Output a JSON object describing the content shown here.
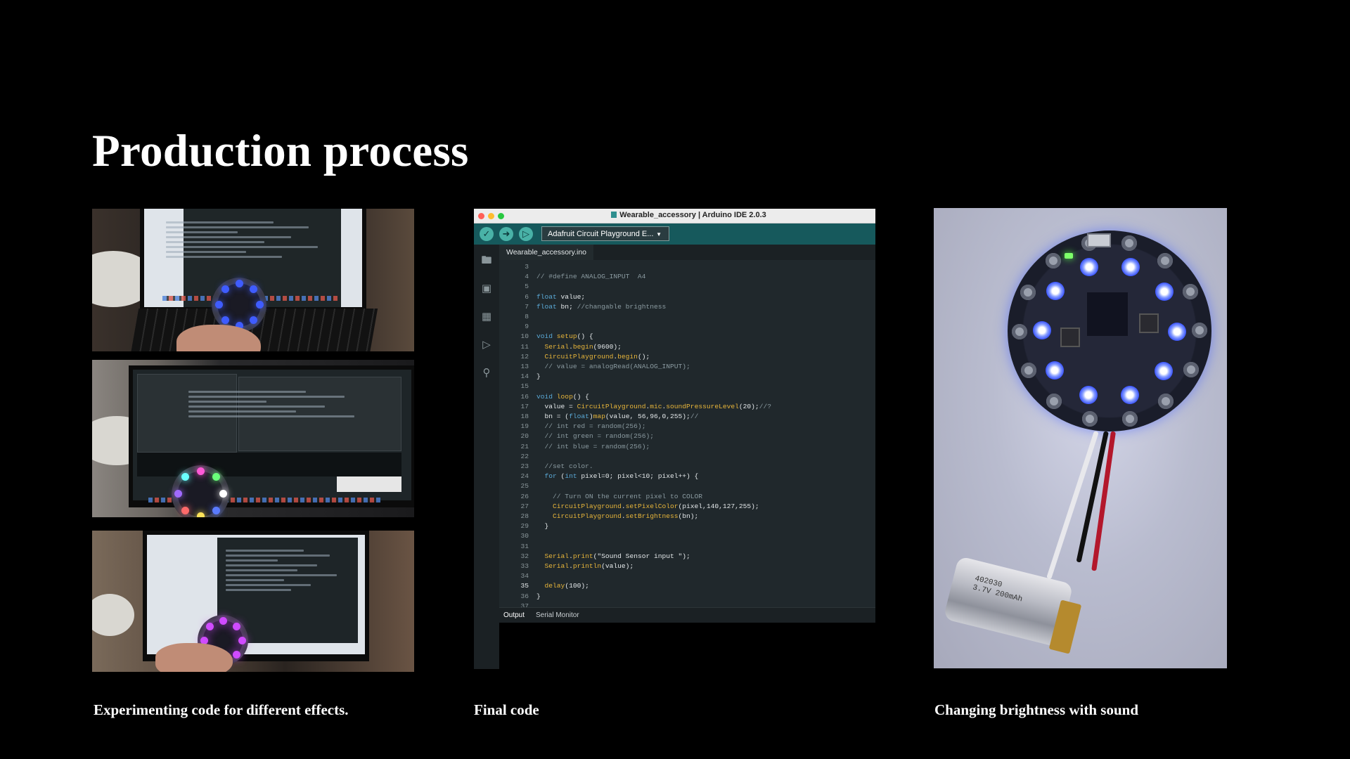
{
  "slide": {
    "title": "Production process",
    "captions": {
      "left": "Experimenting code for different effects.",
      "middle": "Final code",
      "right": "Changing brightness with sound"
    }
  },
  "ide": {
    "window_title": "Wearable_accessory | Arduino IDE 2.0.3",
    "board_select": "Adafruit Circuit Playground E...",
    "file_tab": "Wearable_accessory.ino",
    "output_tabs": [
      "Output",
      "Serial Monitor"
    ],
    "current_line": 35,
    "line_numbers": [
      3,
      4,
      5,
      6,
      7,
      8,
      9,
      10,
      11,
      12,
      13,
      14,
      15,
      16,
      17,
      18,
      19,
      20,
      21,
      22,
      23,
      24,
      25,
      26,
      27,
      28,
      29,
      30,
      31,
      32,
      33,
      34,
      35,
      36,
      37
    ],
    "code_lines": [
      "",
      "// #define ANALOG_INPUT  A4",
      "",
      "float value;",
      "float bn; //changable brightness",
      "",
      "",
      "void setup() {",
      "  Serial.begin(9600);",
      "  CircuitPlayground.begin();",
      "  // value = analogRead(ANALOG_INPUT);",
      "}",
      "",
      "void loop() {",
      "  value = CircuitPlayground.mic.soundPressureLevel(20);//?",
      "  bn = (float)map(value, 56,96,0,255);//",
      "  // int red = random(256);",
      "  // int green = random(256);",
      "  // int blue = random(256);",
      "",
      "  //set color.",
      "  for (int pixel=0; pixel<10; pixel++) {",
      "",
      "    // Turn ON the current pixel to COLOR",
      "    CircuitPlayground.setPixelColor(pixel,140,127,255);",
      "    CircuitPlayground.setBrightness(bn);",
      "  }",
      "",
      "",
      "  Serial.print(\"Sound Sensor input \");",
      "  Serial.println(value);",
      "",
      "  delay(100);",
      "}",
      ""
    ],
    "icons": {
      "verify": "check-icon",
      "upload": "arrow-right-icon",
      "debug": "debug-icon",
      "sketchbook": "folder-icon",
      "boards": "board-icon",
      "library": "library-icon",
      "debug_side": "debug-icon",
      "search": "search-icon"
    }
  },
  "photo_right_text": {
    "battery_label": "402030\n3.7V 200mAh"
  },
  "colors": {
    "ide_teal": "#16595c",
    "button_teal": "#49b2a7",
    "led_blue": "#3b55ff",
    "led_purple": "#d04bff"
  }
}
